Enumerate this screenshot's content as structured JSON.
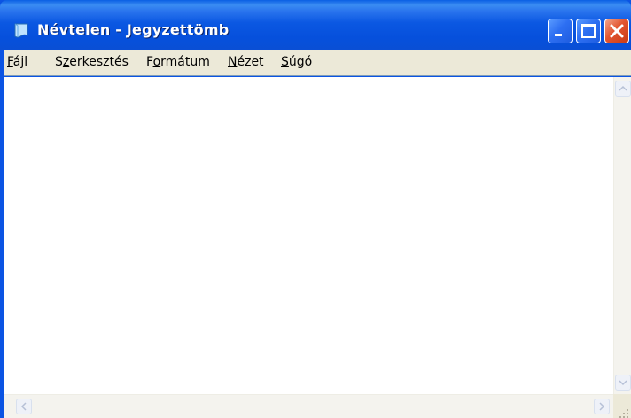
{
  "window": {
    "title": "Névtelen - Jegyzettömb",
    "icon": "notepad-icon",
    "buttons": {
      "minimize": "minimize-icon",
      "maximize": "maximize-icon",
      "close": "close-icon"
    }
  },
  "menu": {
    "items": [
      {
        "accel": "F",
        "rest": "ájl"
      },
      {
        "pre": "S",
        "accel": "z",
        "rest": "erkesztés"
      },
      {
        "pre": "F",
        "accel": "o",
        "rest": "rmátum"
      },
      {
        "accel": "N",
        "rest": "ézet"
      },
      {
        "accel": "S",
        "rest": "úgó"
      }
    ]
  },
  "editor": {
    "content": ""
  },
  "colors": {
    "titlebar": "#0b58e2",
    "menubar": "#ece9d8",
    "close_button": "#e2542f"
  }
}
